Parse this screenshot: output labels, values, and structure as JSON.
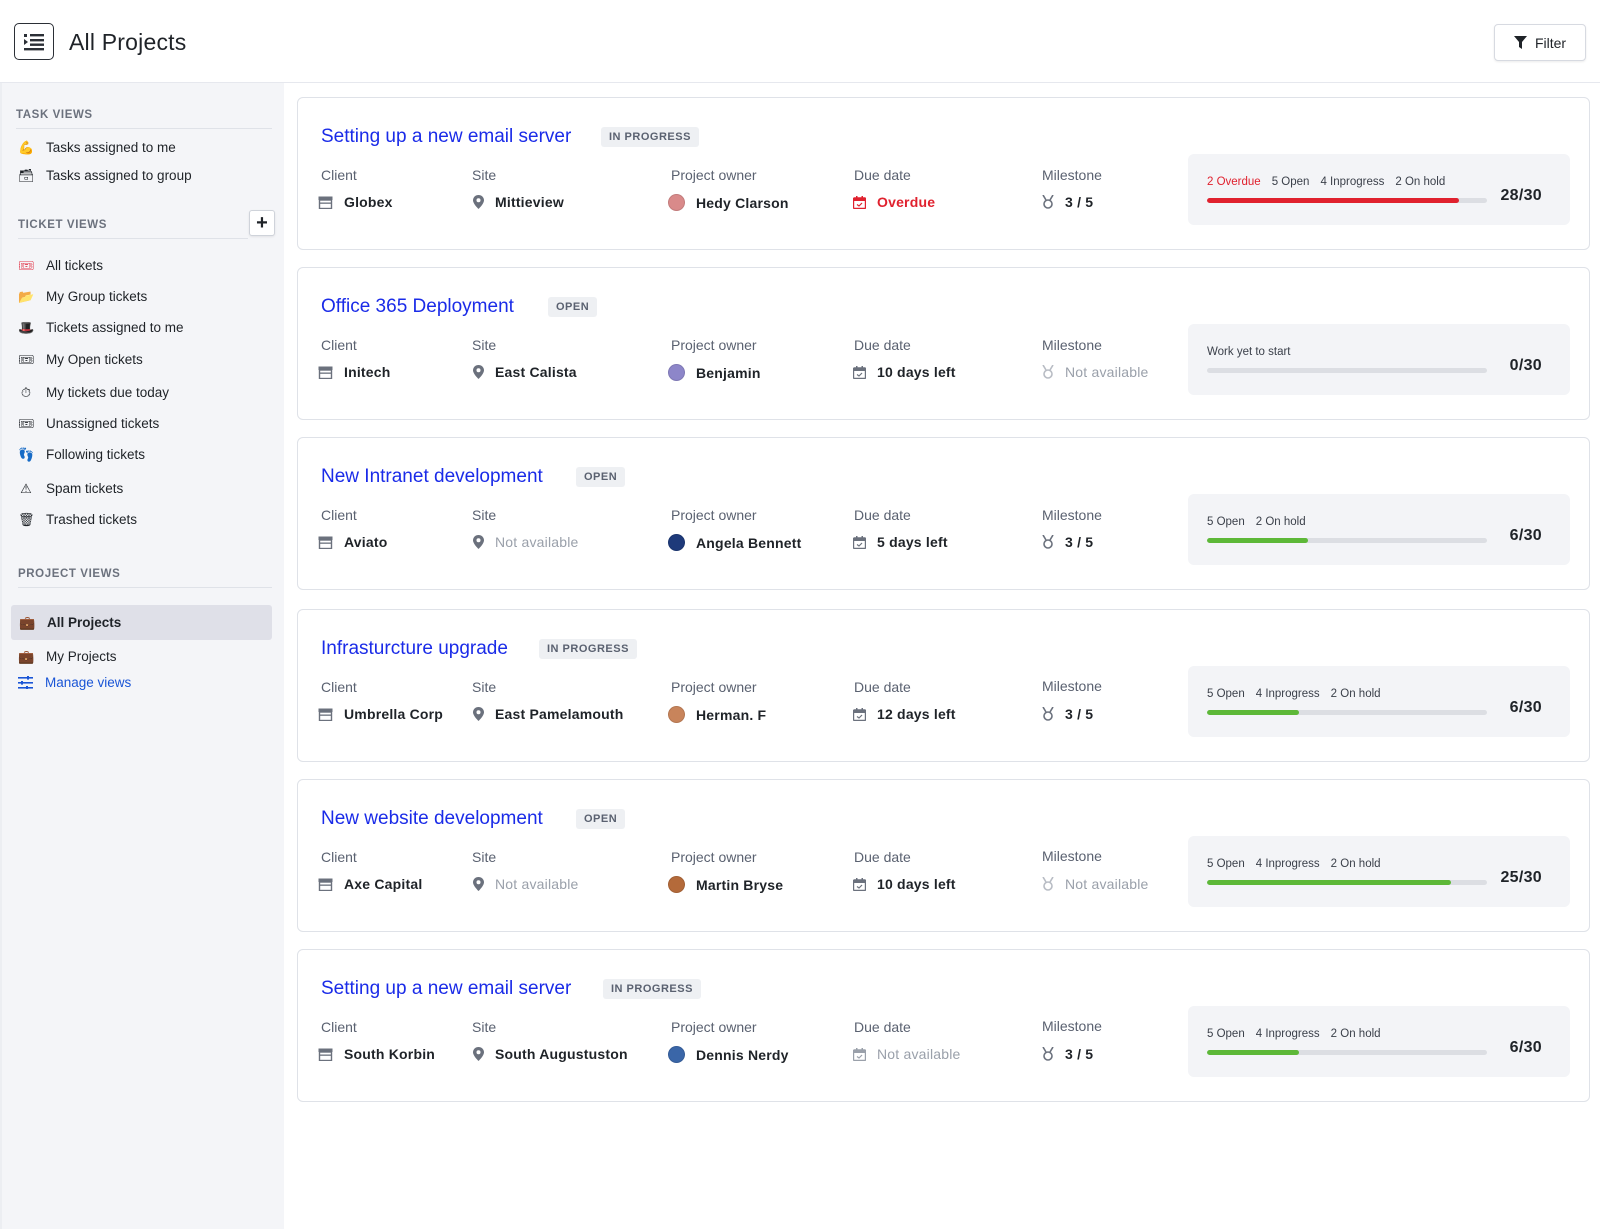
{
  "header": {
    "title": "All Projects",
    "filter_label": "Filter"
  },
  "sidebar": {
    "task_views": {
      "heading": "TASK VIEWS",
      "items": [
        {
          "label": "Tasks assigned to me",
          "icon": "flexed-arm-icon"
        },
        {
          "label": "Tasks assigned to group",
          "icon": "card-stack-icon"
        }
      ]
    },
    "ticket_views": {
      "heading": "TICKET VIEWS",
      "add_label": "+",
      "items": [
        {
          "label": "All tickets",
          "icon": "ticket-icon"
        },
        {
          "label": "My Group tickets",
          "icon": "folder-icon"
        },
        {
          "label": "Tickets assigned to me",
          "icon": "top-hat-icon"
        },
        {
          "label": "My Open tickets",
          "icon": "ticket-icon"
        },
        {
          "label": "My tickets due today",
          "icon": "stopwatch-icon"
        },
        {
          "label": "Unassigned tickets",
          "icon": "ticket-icon"
        },
        {
          "label": "Following tickets",
          "icon": "footprints-icon"
        },
        {
          "label": "Spam tickets",
          "icon": "warning-icon"
        },
        {
          "label": "Trashed tickets",
          "icon": "trash-icon"
        }
      ]
    },
    "project_views": {
      "heading": "PROJECT VIEWS",
      "items": [
        {
          "label": "All Projects",
          "icon": "briefcase-icon",
          "active": true
        },
        {
          "label": "My Projects",
          "icon": "briefcase-icon",
          "active": false
        }
      ]
    },
    "manage_views": "Manage views"
  },
  "labels": {
    "client": "Client",
    "site": "Site",
    "owner": "Project owner",
    "due": "Due date",
    "milestone": "Milestone"
  },
  "colors": {
    "link": "#1a2be8",
    "overdue": "#e0212e",
    "progress_green": "#5db838"
  },
  "projects": [
    {
      "title": "Setting up a new email server",
      "status": "IN PROGRESS",
      "client": "Globex",
      "site": "Mittieview",
      "owner": "Hedy Clarson",
      "due": "Overdue",
      "milestone": "3 / 5",
      "stats": {
        "overdue": "2 Overdue",
        "open": "5 Open",
        "inprogress": "4 Inprogress",
        "onhold": "2 On hold"
      },
      "progress": 0.9,
      "bar_color": "#e0212e",
      "count": "28/30"
    },
    {
      "title": "Office 365 Deployment",
      "status": "OPEN",
      "client": "Initech",
      "site": "East Calista",
      "owner": "Benjamin",
      "due": "10 days left",
      "milestone": "Not available",
      "stats": {
        "note": "Work yet to start"
      },
      "progress": 0,
      "bar_color": "#5db838",
      "count": "0/30"
    },
    {
      "title": "New Intranet development",
      "status": "OPEN",
      "client": "Aviato",
      "site": "Not available",
      "owner": "Angela Bennett",
      "due": "5 days left",
      "milestone": "3 / 5",
      "stats": {
        "open": "5 Open",
        "onhold": "2 On hold"
      },
      "progress": 0.36,
      "bar_color": "#5db838",
      "count": "6/30"
    },
    {
      "title": "Infrasturcture upgrade",
      "status": "IN PROGRESS",
      "client": "Umbrella Corp",
      "site": "East Pamelamouth",
      "owner": "Herman. F",
      "due": "12 days left",
      "milestone": "3 / 5",
      "stats": {
        "open": "5  Open",
        "inprogress": "4  Inprogress",
        "onhold": "2  On hold"
      },
      "progress": 0.33,
      "bar_color": "#5db838",
      "count": "6/30"
    },
    {
      "title": "New website development",
      "status": "OPEN",
      "client": "Axe Capital",
      "site": "Not available",
      "owner": "Martin Bryse",
      "due": "10 days left",
      "milestone": "Not available",
      "stats": {
        "open": "5  Open",
        "inprogress": "4  Inprogress",
        "onhold": "2  On hold"
      },
      "progress": 0.87,
      "bar_color": "#5db838",
      "count": "25/30"
    },
    {
      "title": "Setting up a new email server",
      "status": "IN PROGRESS",
      "client": "South Korbin",
      "site": "South Augustuston",
      "owner": "Dennis Nerdy",
      "due": "Not available",
      "milestone": "3 / 5",
      "stats": {
        "open": "5  Open",
        "inprogress": "4  Inprogress",
        "onhold": "2  On hold"
      },
      "progress": 0.33,
      "bar_color": "#5db838",
      "count": "6/30"
    }
  ]
}
